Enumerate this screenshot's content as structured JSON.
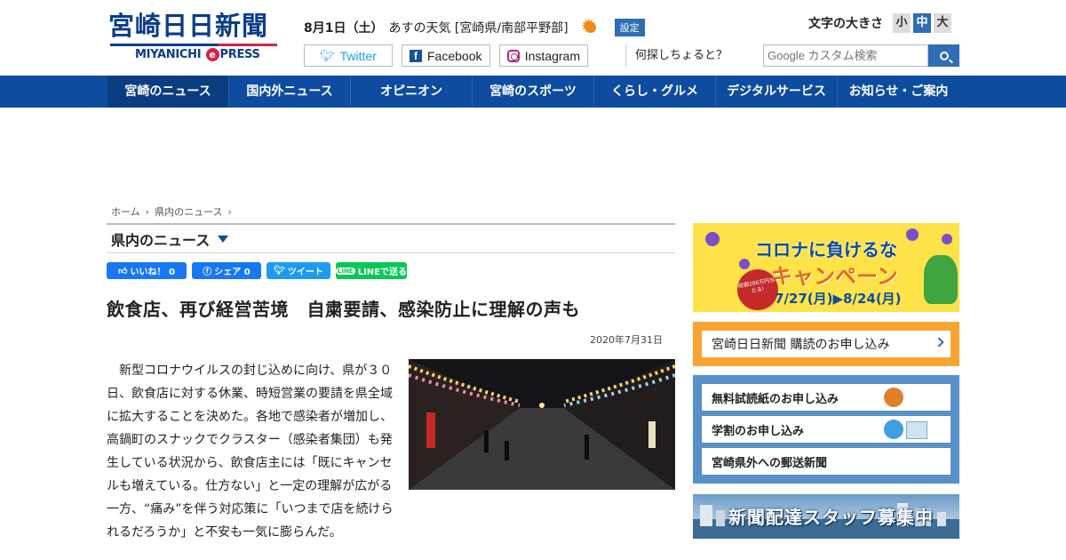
{
  "header": {
    "logo_main": "宮崎日日新聞",
    "logo_sub_before": "MIYANICHI",
    "logo_sub_e": "e",
    "logo_sub_after": "PRESS",
    "weather_date": "8月1日（土）",
    "weather_label": "あすの天気 [宮崎県/南部平野部]",
    "settings_label": "設定",
    "font_size_label": "文字の大きさ",
    "font_size_options": [
      "小",
      "中",
      "大"
    ],
    "font_size_active": "中",
    "social": {
      "twitter": "Twitter",
      "facebook": "Facebook",
      "instagram": "Instagram"
    },
    "search_prompt": "何探しちょると？",
    "search_placeholder": "Google カスタム検索"
  },
  "nav": {
    "items": [
      "宮崎のニュース",
      "国内外ニュース",
      "オピニオン",
      "宮崎のスポーツ",
      "くらし・グルメ",
      "デジタルサービス",
      "お知らせ・ご案内"
    ]
  },
  "breadcrumb": [
    "ホーム",
    "県内のニュース"
  ],
  "section": {
    "title": "県内のニュース"
  },
  "share": {
    "like": "いいね！ 0",
    "share": "シェア 0",
    "tweet": "ツイート",
    "line_badge": "LINE",
    "line": "LINEで送る"
  },
  "article": {
    "headline": "飲食店、再び経営苦境　自粛要請、感染防止に理解の声も",
    "date": "2020年7月31日",
    "body": "新型コロナウイルスの封じ込めに向け、県が３０日、飲食店に対する休業、時短営業の要請を県全域に拡大することを決めた。各地で感染者が増加し、高鍋町のスナックでクラスター（感染者集団）も発生している状況から、飲食店主には「既にキャンセルも増えている。仕方ない」と一定の理解が広がる一方、“痛み”を伴う対応策に「いつまで店を続けられるだろうか」と不安も一気に膨らんだ。"
  },
  "sidebar": {
    "corona_title": "コロナに負けるな",
    "corona_campaign": "キャンペーン",
    "corona_dates": "7/27(月)▶8/24(月)",
    "corona_badge": "総額206万円当たる!",
    "subscribe": "宮崎日日新聞 購読のお申し込み",
    "links": [
      "無料試読紙のお申し込み",
      "学割のお申し込み",
      "宮崎県外への郵送新聞"
    ],
    "staff_banner": "新聞配達スタッフ募集中"
  }
}
